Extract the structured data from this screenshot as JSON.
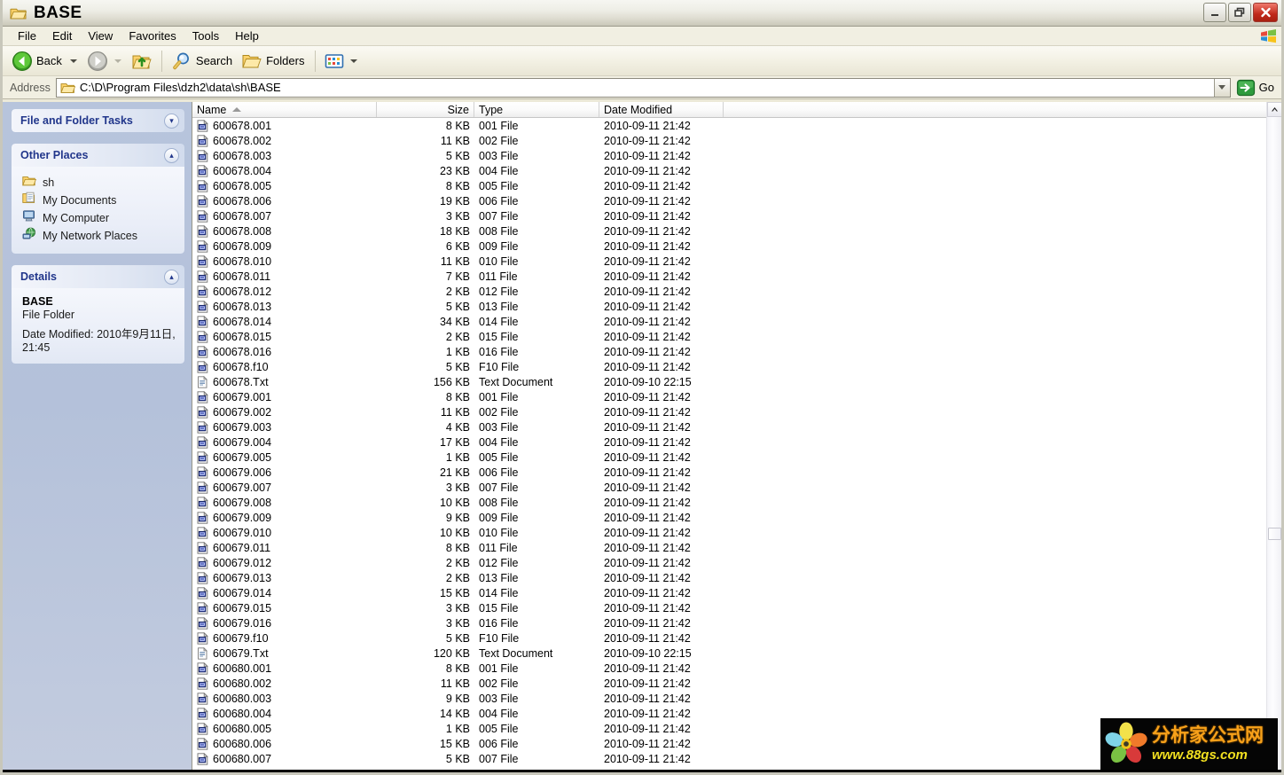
{
  "window": {
    "title": "BASE",
    "folder_icon": "folder-icon",
    "buttons": {
      "minimize": "minimize-button",
      "restore": "restore-button",
      "close": "close-button"
    }
  },
  "menubar": {
    "items": [
      "File",
      "Edit",
      "View",
      "Favorites",
      "Tools",
      "Help"
    ],
    "logo": "windows-flag-icon"
  },
  "toolbar": {
    "back_label": "Back",
    "forward_label": "",
    "up_label": "",
    "search_label": "Search",
    "folders_label": "Folders",
    "views_label": ""
  },
  "address": {
    "label": "Address",
    "value": "C:\\D\\Program Files\\dzh2\\data\\sh\\BASE",
    "go_label": "Go"
  },
  "taskpane": {
    "file_folder_tasks": {
      "title": "File and Folder Tasks",
      "state": "collapsed",
      "chevron": "chevron-double-down-icon"
    },
    "other_places": {
      "title": "Other Places",
      "chevron": "chevron-double-up-icon",
      "items": [
        {
          "label": "sh",
          "icon": "folder-icon"
        },
        {
          "label": "My Documents",
          "icon": "my-documents-icon"
        },
        {
          "label": "My Computer",
          "icon": "my-computer-icon"
        },
        {
          "label": "My Network Places",
          "icon": "network-places-icon"
        }
      ]
    },
    "details": {
      "title": "Details",
      "chevron": "chevron-double-up-icon",
      "name": "BASE",
      "type": "File Folder",
      "date_modified": "Date Modified: 2010年9月11日, 21:45"
    }
  },
  "filelist": {
    "columns": [
      "Name",
      "Size",
      "Type",
      "Date Modified"
    ],
    "sort_column": "Name",
    "sort_direction": "ascending",
    "rows": [
      {
        "name": "600678.001",
        "size": "8 KB",
        "type": "001 File",
        "date": "2010-09-11 21:42",
        "icon": "generic-file-icon"
      },
      {
        "name": "600678.002",
        "size": "11 KB",
        "type": "002 File",
        "date": "2010-09-11 21:42",
        "icon": "generic-file-icon"
      },
      {
        "name": "600678.003",
        "size": "5 KB",
        "type": "003 File",
        "date": "2010-09-11 21:42",
        "icon": "generic-file-icon"
      },
      {
        "name": "600678.004",
        "size": "23 KB",
        "type": "004 File",
        "date": "2010-09-11 21:42",
        "icon": "generic-file-icon"
      },
      {
        "name": "600678.005",
        "size": "8 KB",
        "type": "005 File",
        "date": "2010-09-11 21:42",
        "icon": "generic-file-icon"
      },
      {
        "name": "600678.006",
        "size": "19 KB",
        "type": "006 File",
        "date": "2010-09-11 21:42",
        "icon": "generic-file-icon"
      },
      {
        "name": "600678.007",
        "size": "3 KB",
        "type": "007 File",
        "date": "2010-09-11 21:42",
        "icon": "generic-file-icon"
      },
      {
        "name": "600678.008",
        "size": "18 KB",
        "type": "008 File",
        "date": "2010-09-11 21:42",
        "icon": "generic-file-icon"
      },
      {
        "name": "600678.009",
        "size": "6 KB",
        "type": "009 File",
        "date": "2010-09-11 21:42",
        "icon": "generic-file-icon"
      },
      {
        "name": "600678.010",
        "size": "11 KB",
        "type": "010 File",
        "date": "2010-09-11 21:42",
        "icon": "generic-file-icon"
      },
      {
        "name": "600678.011",
        "size": "7 KB",
        "type": "011 File",
        "date": "2010-09-11 21:42",
        "icon": "generic-file-icon"
      },
      {
        "name": "600678.012",
        "size": "2 KB",
        "type": "012 File",
        "date": "2010-09-11 21:42",
        "icon": "generic-file-icon"
      },
      {
        "name": "600678.013",
        "size": "5 KB",
        "type": "013 File",
        "date": "2010-09-11 21:42",
        "icon": "generic-file-icon"
      },
      {
        "name": "600678.014",
        "size": "34 KB",
        "type": "014 File",
        "date": "2010-09-11 21:42",
        "icon": "generic-file-icon"
      },
      {
        "name": "600678.015",
        "size": "2 KB",
        "type": "015 File",
        "date": "2010-09-11 21:42",
        "icon": "generic-file-icon"
      },
      {
        "name": "600678.016",
        "size": "1 KB",
        "type": "016 File",
        "date": "2010-09-11 21:42",
        "icon": "generic-file-icon"
      },
      {
        "name": "600678.f10",
        "size": "5 KB",
        "type": "F10 File",
        "date": "2010-09-11 21:42",
        "icon": "generic-file-icon"
      },
      {
        "name": "600678.Txt",
        "size": "156 KB",
        "type": "Text Document",
        "date": "2010-09-10 22:15",
        "icon": "text-document-icon"
      },
      {
        "name": "600679.001",
        "size": "8 KB",
        "type": "001 File",
        "date": "2010-09-11 21:42",
        "icon": "generic-file-icon"
      },
      {
        "name": "600679.002",
        "size": "11 KB",
        "type": "002 File",
        "date": "2010-09-11 21:42",
        "icon": "generic-file-icon"
      },
      {
        "name": "600679.003",
        "size": "4 KB",
        "type": "003 File",
        "date": "2010-09-11 21:42",
        "icon": "generic-file-icon"
      },
      {
        "name": "600679.004",
        "size": "17 KB",
        "type": "004 File",
        "date": "2010-09-11 21:42",
        "icon": "generic-file-icon"
      },
      {
        "name": "600679.005",
        "size": "1 KB",
        "type": "005 File",
        "date": "2010-09-11 21:42",
        "icon": "generic-file-icon"
      },
      {
        "name": "600679.006",
        "size": "21 KB",
        "type": "006 File",
        "date": "2010-09-11 21:42",
        "icon": "generic-file-icon"
      },
      {
        "name": "600679.007",
        "size": "3 KB",
        "type": "007 File",
        "date": "2010-09-11 21:42",
        "icon": "generic-file-icon"
      },
      {
        "name": "600679.008",
        "size": "10 KB",
        "type": "008 File",
        "date": "2010-09-11 21:42",
        "icon": "generic-file-icon"
      },
      {
        "name": "600679.009",
        "size": "9 KB",
        "type": "009 File",
        "date": "2010-09-11 21:42",
        "icon": "generic-file-icon"
      },
      {
        "name": "600679.010",
        "size": "10 KB",
        "type": "010 File",
        "date": "2010-09-11 21:42",
        "icon": "generic-file-icon"
      },
      {
        "name": "600679.011",
        "size": "8 KB",
        "type": "011 File",
        "date": "2010-09-11 21:42",
        "icon": "generic-file-icon"
      },
      {
        "name": "600679.012",
        "size": "2 KB",
        "type": "012 File",
        "date": "2010-09-11 21:42",
        "icon": "generic-file-icon"
      },
      {
        "name": "600679.013",
        "size": "2 KB",
        "type": "013 File",
        "date": "2010-09-11 21:42",
        "icon": "generic-file-icon"
      },
      {
        "name": "600679.014",
        "size": "15 KB",
        "type": "014 File",
        "date": "2010-09-11 21:42",
        "icon": "generic-file-icon"
      },
      {
        "name": "600679.015",
        "size": "3 KB",
        "type": "015 File",
        "date": "2010-09-11 21:42",
        "icon": "generic-file-icon"
      },
      {
        "name": "600679.016",
        "size": "3 KB",
        "type": "016 File",
        "date": "2010-09-11 21:42",
        "icon": "generic-file-icon"
      },
      {
        "name": "600679.f10",
        "size": "5 KB",
        "type": "F10 File",
        "date": "2010-09-11 21:42",
        "icon": "generic-file-icon"
      },
      {
        "name": "600679.Txt",
        "size": "120 KB",
        "type": "Text Document",
        "date": "2010-09-10 22:15",
        "icon": "text-document-icon"
      },
      {
        "name": "600680.001",
        "size": "8 KB",
        "type": "001 File",
        "date": "2010-09-11 21:42",
        "icon": "generic-file-icon"
      },
      {
        "name": "600680.002",
        "size": "11 KB",
        "type": "002 File",
        "date": "2010-09-11 21:42",
        "icon": "generic-file-icon"
      },
      {
        "name": "600680.003",
        "size": "9 KB",
        "type": "003 File",
        "date": "2010-09-11 21:42",
        "icon": "generic-file-icon"
      },
      {
        "name": "600680.004",
        "size": "14 KB",
        "type": "004 File",
        "date": "2010-09-11 21:42",
        "icon": "generic-file-icon"
      },
      {
        "name": "600680.005",
        "size": "1 KB",
        "type": "005 File",
        "date": "2010-09-11 21:42",
        "icon": "generic-file-icon"
      },
      {
        "name": "600680.006",
        "size": "15 KB",
        "type": "006 File",
        "date": "2010-09-11 21:42",
        "icon": "generic-file-icon"
      },
      {
        "name": "600680.007",
        "size": "5 KB",
        "type": "007 File",
        "date": "2010-09-11 21:42",
        "icon": "generic-file-icon"
      }
    ]
  },
  "watermark": {
    "cn_text": "分析家公式网",
    "url": "www.88gs.com"
  },
  "colors": {
    "taskpane_blue": "#b7c4dc",
    "panel_title": "#21368b",
    "close_red": "#c0291a",
    "watermark_orange": "#f7a11a",
    "watermark_yellow": "#f2e020"
  }
}
